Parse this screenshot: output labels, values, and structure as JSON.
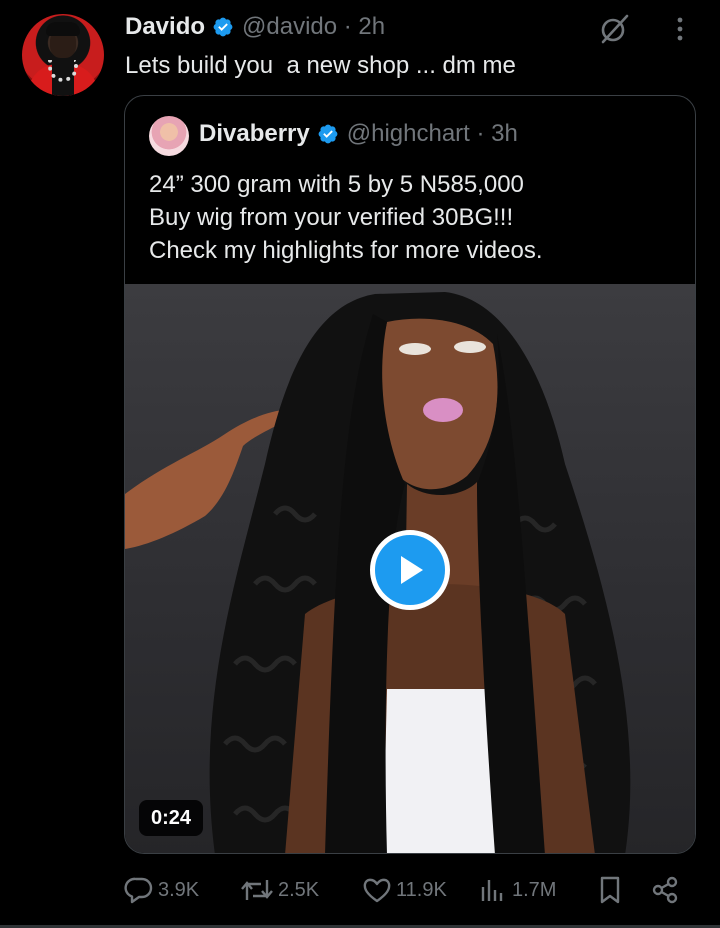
{
  "post": {
    "author_name": "Davido",
    "handle_time": "@davido · 2h",
    "text": "Lets build you  a new shop ... dm me"
  },
  "quote": {
    "author_name": "Divaberry",
    "handle_time": "@highchart · 3h",
    "lines": [
      "24” 300 gram with 5 by 5 N585,000",
      "Buy wig from your verified 30BG!!!",
      "Check my highlights for more videos."
    ],
    "video_duration": "0:24"
  },
  "actions": {
    "replies": "3.9K",
    "reposts": "2.5K",
    "likes": "11.9K",
    "views": "1.7M"
  },
  "icons": {
    "verified": "verified-badge-icon",
    "grok": "grok-icon",
    "more": "more-icon",
    "play": "play-icon",
    "reply": "reply-icon",
    "repost": "repost-icon",
    "like": "heart-icon",
    "views": "views-icon",
    "bookmark": "bookmark-icon",
    "share": "share-icon"
  },
  "colors": {
    "background": "#000000",
    "text": "#e7e9ea",
    "muted": "#71767b",
    "accent": "#1d9bf0"
  }
}
